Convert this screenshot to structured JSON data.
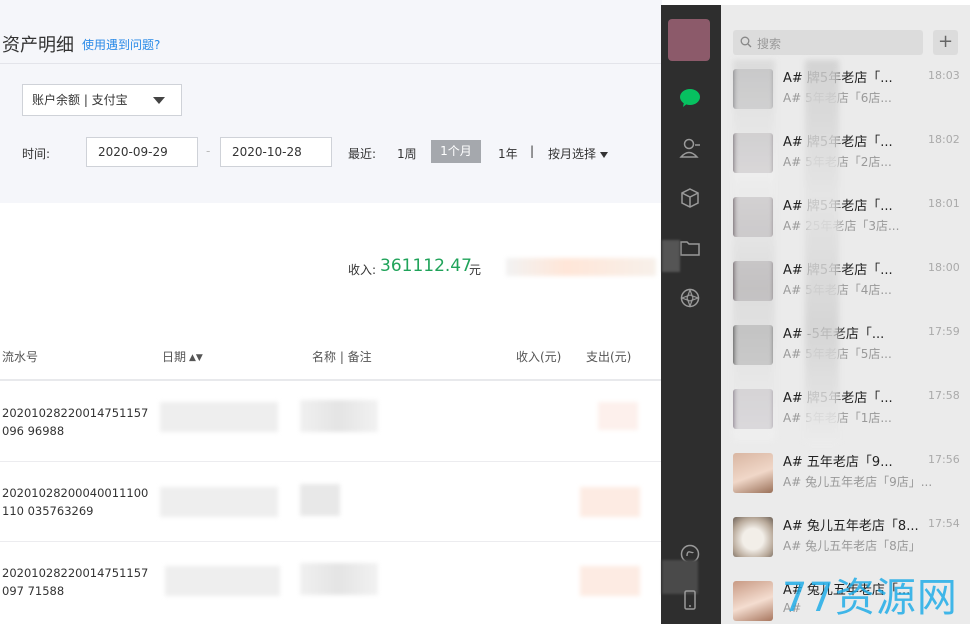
{
  "page": {
    "title": "资产明细",
    "help_link": "使用遇到问题?",
    "account_select": "账户余额 | 支付宝",
    "time_label": "时间:",
    "date_from": "2020-09-29",
    "date_sep": "-",
    "date_to": "2020-10-28",
    "recent_label": "最近:",
    "range_week": "1周",
    "range_month": "1个月",
    "range_year": "1年",
    "range_divider": "|",
    "month_select": "按月选择",
    "income_label": "收入:",
    "income_value": "361112.47",
    "income_unit": "元"
  },
  "table": {
    "headers": {
      "serial": "流水号",
      "date": "日期",
      "name": "名称 | 备注",
      "income": "收入(元)",
      "expense": "支出(元)"
    },
    "rows": [
      {
        "serial": "20201028220014751157096 96988"
      },
      {
        "serial": "20201028200040011100110 035763269"
      },
      {
        "serial": "20201028220014751157097 71588"
      }
    ]
  },
  "sidebar": {
    "search_placeholder": "搜索",
    "add_label": "+",
    "chats": [
      {
        "name": "A# 牌5年老店「...",
        "time": "18:03",
        "preview": "A# 5年老店「6店..."
      },
      {
        "name": "A# 牌5年老店「...",
        "time": "18:02",
        "preview": "A# 5年老店「2店..."
      },
      {
        "name": "A# 牌5年老店「...",
        "time": "18:01",
        "preview": "A# 25年老店「3店..."
      },
      {
        "name": "A# 牌5年老店「...",
        "time": "18:00",
        "preview": "A# 5年老店「4店..."
      },
      {
        "name": "A# -5年老店「...",
        "time": "17:59",
        "preview": "A# 5年老店「5店..."
      },
      {
        "name": "A# 牌5年老店「...",
        "time": "17:58",
        "preview": "A# 5年老店「1店..."
      },
      {
        "name": "A# 五年老店「9...",
        "time": "17:56",
        "preview": "A# 兔儿五年老店「9店」..."
      },
      {
        "name": "A# 兔儿五年老店「8...",
        "time": "17:54",
        "preview": "A# 兔儿五年老店「8店」"
      },
      {
        "name": "A# 兔儿五年老店「...",
        "time": "",
        "preview": "A#"
      }
    ]
  },
  "watermark": "77资源网",
  "colors": {
    "accent_green": "#20a35a",
    "link_blue": "#2b8be8",
    "nav_dark": "#2e2e2e",
    "chat_green": "#07c160"
  }
}
